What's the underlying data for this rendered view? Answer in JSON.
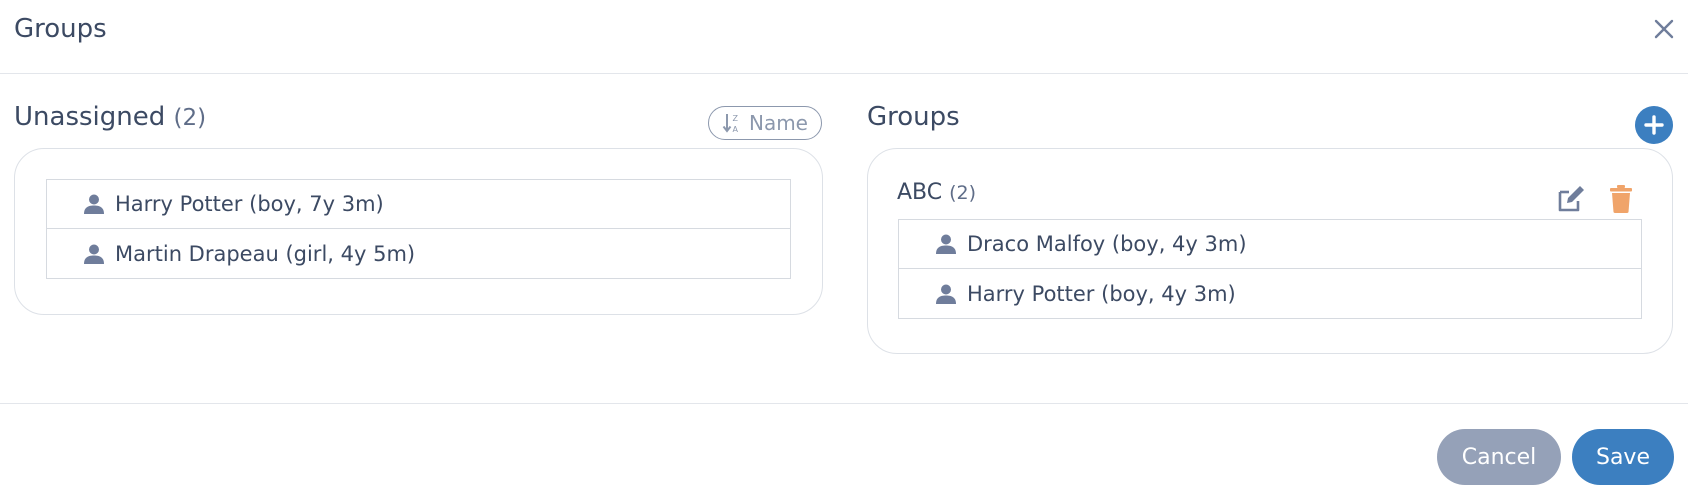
{
  "modal": {
    "title": "Groups"
  },
  "unassigned": {
    "title": "Unassigned",
    "count": "(2)",
    "sort_label": "Name",
    "members": [
      {
        "label": "Harry Potter (boy, 7y 3m)"
      },
      {
        "label": "Martin Drapeau (girl, 4y 5m)"
      }
    ]
  },
  "groups": {
    "title": "Groups",
    "items": [
      {
        "name": "ABC",
        "count": "(2)",
        "members": [
          {
            "label": "Draco Malfoy (boy, 4y 3m)"
          },
          {
            "label": "Harry Potter (boy, 4y 3m)"
          }
        ]
      }
    ]
  },
  "footer": {
    "cancel_label": "Cancel",
    "save_label": "Save"
  },
  "colors": {
    "primary": "#3c7fc0",
    "cancel": "#95a1b8",
    "text": "#3c4a63",
    "icon": "#6f7d9b",
    "delete": "#f0a46a"
  }
}
